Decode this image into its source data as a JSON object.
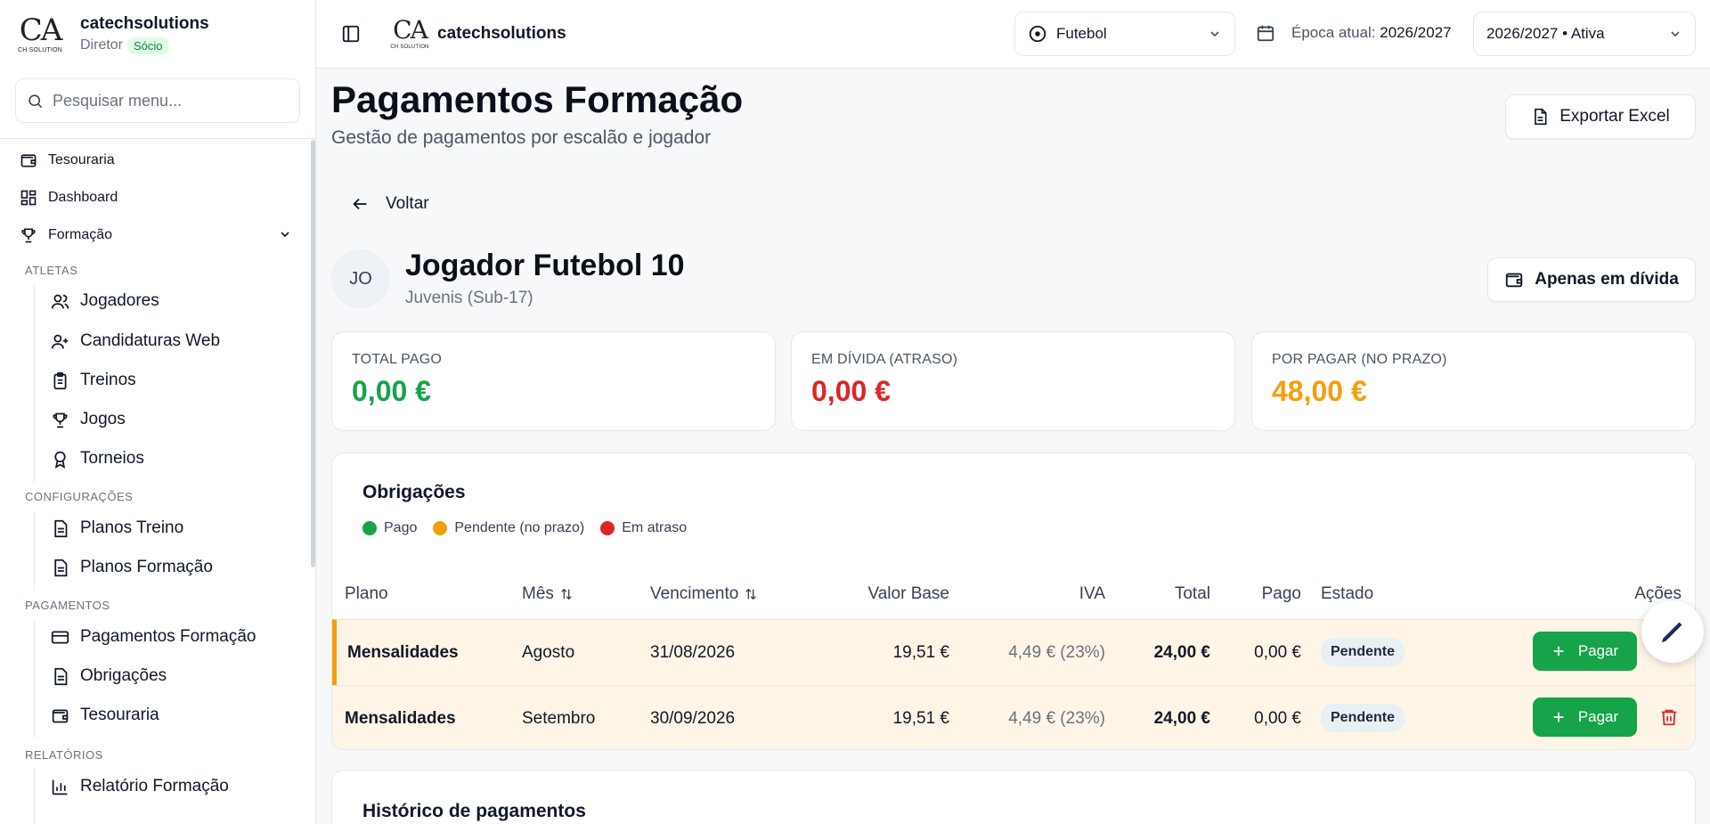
{
  "sidebar": {
    "brand_name": "catechsolutions",
    "logo_text": "CA",
    "logo_sub": "CH SOLUTION",
    "role": "Diretor",
    "role_badge": "Sócio",
    "search_placeholder": "Pesquisar menu...",
    "top_items": [
      "Tesouraria",
      "Dashboard",
      "Formação"
    ],
    "sections": [
      {
        "label": "ATLETAS",
        "items": [
          "Jogadores",
          "Candidaturas Web",
          "Treinos",
          "Jogos",
          "Torneios"
        ]
      },
      {
        "label": "CONFIGURAÇÕES",
        "items": [
          "Planos Treino",
          "Planos Formação"
        ]
      },
      {
        "label": "PAGAMENTOS",
        "items": [
          "Pagamentos Formação",
          "Obrigações",
          "Tesouraria"
        ]
      },
      {
        "label": "RELATÓRIOS",
        "items": [
          "Relatório Formação"
        ]
      }
    ]
  },
  "topbar": {
    "brand_name": "catechsolutions",
    "sport": "Futebol",
    "season_label": "Época atual:",
    "season_value": "2026/2027",
    "season_select": "2026/2027 • Ativa"
  },
  "page": {
    "title": "Pagamentos Formação",
    "subtitle": "Gestão de pagamentos por escalão e jogador",
    "export_label": "Exportar Excel",
    "back_label": "Voltar"
  },
  "player": {
    "initials": "JO",
    "name": "Jogador Futebol 10",
    "group": "Juvenis (Sub-17)",
    "debt_filter_label": "Apenas em dívida"
  },
  "stats": [
    {
      "label": "TOTAL PAGO",
      "value": "0,00 €",
      "color": "#16a34a"
    },
    {
      "label": "EM DÍVIDA (ATRASO)",
      "value": "0,00 €",
      "color": "#dc2626"
    },
    {
      "label": "POR PAGAR (NO PRAZO)",
      "value": "48,00 €",
      "color": "#f59e0b"
    }
  ],
  "obligations": {
    "title": "Obrigações",
    "legend": [
      {
        "label": "Pago",
        "color": "#16a34a"
      },
      {
        "label": "Pendente (no prazo)",
        "color": "#f59e0b"
      },
      {
        "label": "Em atraso",
        "color": "#dc2626"
      }
    ],
    "columns": [
      "Plano",
      "Mês",
      "Vencimento",
      "Valor Base",
      "IVA",
      "Total",
      "Pago",
      "Estado",
      "Ações"
    ],
    "rows": [
      {
        "plano": "Mensalidades",
        "mes": "Agosto",
        "vencimento": "31/08/2026",
        "valor_base": "19,51 €",
        "iva": "4,49 € (23%)",
        "total": "24,00 €",
        "pago": "0,00 €",
        "estado": "Pendente",
        "action": "Pagar"
      },
      {
        "plano": "Mensalidades",
        "mes": "Setembro",
        "vencimento": "30/09/2026",
        "valor_base": "19,51 €",
        "iva": "4,49 € (23%)",
        "total": "24,00 €",
        "pago": "0,00 €",
        "estado": "Pendente",
        "action": "Pagar"
      }
    ]
  },
  "history": {
    "title": "Histórico de pagamentos"
  }
}
